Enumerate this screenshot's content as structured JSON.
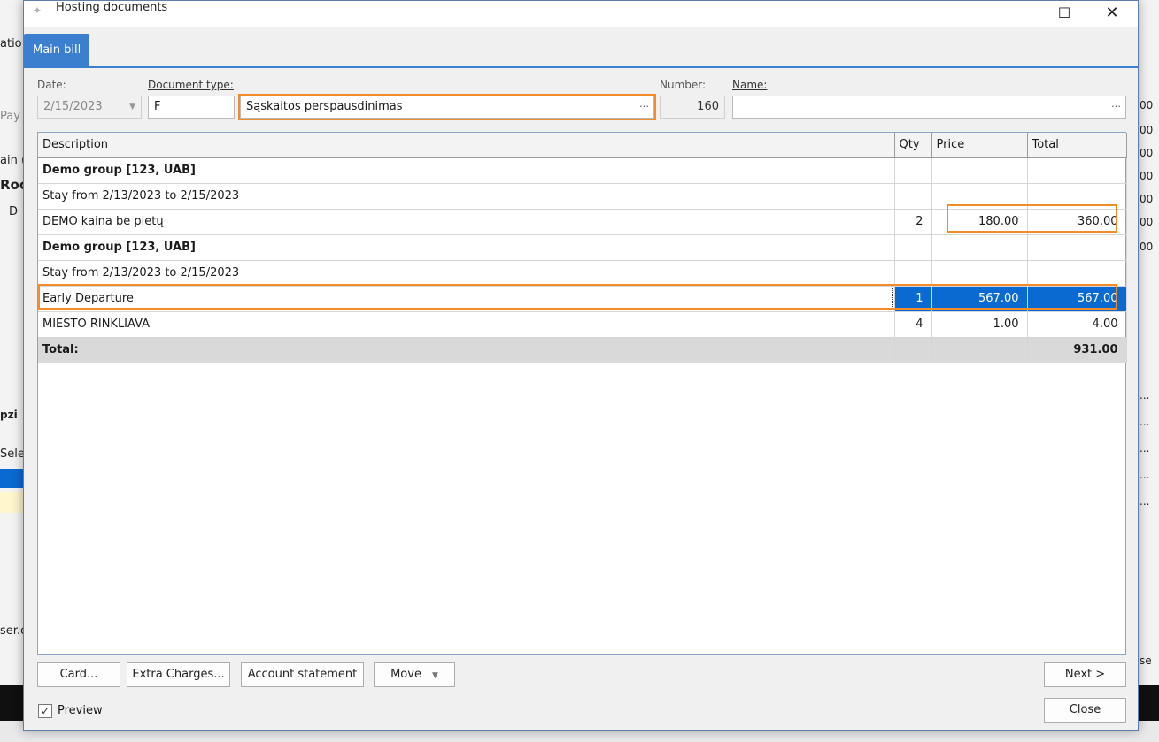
{
  "window": {
    "title": "Hosting documents",
    "maximize_glyph": "☐",
    "close_glyph": "✕"
  },
  "tabs": [
    {
      "label": "Main bill",
      "active": true
    }
  ],
  "form": {
    "date_label": "Date:",
    "date_value": "2/15/2023",
    "doctype_label": "Document type:",
    "doctype_code": "F",
    "doctype_name": "Sąskaitos perspausdinimas",
    "number_label": "Number:",
    "number_value": "160",
    "name_label": "Name:",
    "name_value": ""
  },
  "grid": {
    "columns": [
      "Description",
      "Qty",
      "Price",
      "Total"
    ],
    "rows": [
      {
        "description": "Demo group [123, UAB]",
        "qty": "",
        "price": "",
        "total": "",
        "group": true
      },
      {
        "description": "Stay from 2/13/2023 to 2/15/2023",
        "qty": "",
        "price": "",
        "total": ""
      },
      {
        "description": "DEMO kaina be pietų",
        "qty": "2",
        "price": "180.00",
        "total": "360.00"
      },
      {
        "description": "Demo group [123, UAB]",
        "qty": "",
        "price": "",
        "total": "",
        "group": true
      },
      {
        "description": "Stay from 2/13/2023 to 2/15/2023",
        "qty": "",
        "price": "",
        "total": ""
      },
      {
        "description": "Early Departure",
        "qty": "1",
        "price": "567.00",
        "total": "567.00",
        "selected": true
      },
      {
        "description": "MIESTO RINKLIAVA",
        "qty": "4",
        "price": "1.00",
        "total": "4.00"
      }
    ],
    "total_label": "Total:",
    "total_value": "931.00"
  },
  "buttons": {
    "card": "Card...",
    "extra_charges": "Extra Charges...",
    "account_statement": "Account statement",
    "move": "Move",
    "next": "Next >",
    "close": "Close"
  },
  "preview": {
    "label": "Preview",
    "checked": true
  },
  "background_fragments": {
    "left": [
      "atio",
      "Pay",
      "ain (",
      "Roo",
      "D",
      "pzi",
      "Sele",
      "ser.c"
    ],
    "right": [
      "00",
      "00",
      "00",
      "00",
      "00",
      "00",
      "00",
      "...",
      "...",
      "...",
      "...",
      "...",
      "se"
    ]
  },
  "colors": {
    "accent": "#3d7fcf",
    "selection": "#0a6ad1",
    "highlight": "#f28c28"
  }
}
